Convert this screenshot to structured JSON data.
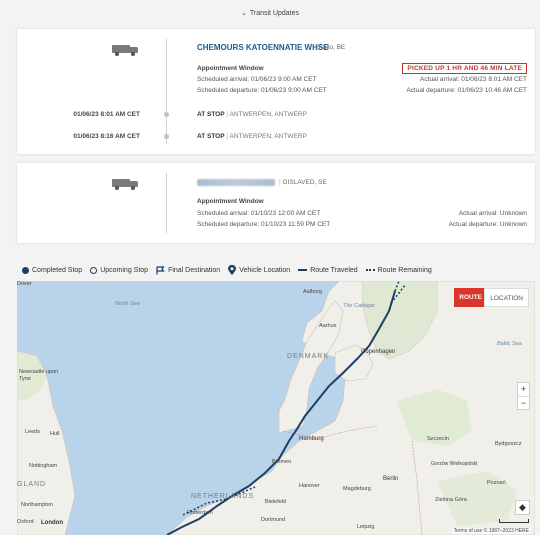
{
  "transit_updates": {
    "label": "Transit Updates"
  },
  "stop1": {
    "name": "CHEMOURS KATOENNATIE WHSE",
    "location": "Kallo, BE",
    "appointment_label": "Appointment Window",
    "scheduled_arrival": "Scheduled arrival: 01/06/23 9:00 AM CET",
    "scheduled_departure": "Scheduled departure: 01/06/23 9:00 AM CET",
    "status_badge": "PICKED UP 1 HR AND 46 MIN LATE",
    "actual_arrival": "Actual arrival: 01/06/23 8:01 AM CET",
    "actual_departure": "Actual departure: 01/06/23 10:46 AM CET",
    "events": [
      {
        "time": "01/06/23 8:01 AM CET",
        "status": "AT STOP",
        "place": "ANTWERPEN, ANTWERP"
      },
      {
        "time": "01/06/23 8:16 AM CET",
        "status": "AT STOP",
        "place": "ANTWERPEN, ANTWERP"
      }
    ]
  },
  "stop2": {
    "location": "GISLAVED, SE",
    "appointment_label": "Appointment Window",
    "scheduled_arrival": "Scheduled arrival: 01/10/23 12:00 AM CET",
    "scheduled_departure": "Scheduled departure: 01/10/23 11:59 PM CET",
    "actual_arrival": "Actual arrival: Unknown",
    "actual_departure": "Actual departure: Unknown"
  },
  "legend": {
    "completed": "Completed Stop",
    "upcoming": "Upcoming Stop",
    "final": "Final Destination",
    "vehicle": "Vehicle Location",
    "traveled": "Route Traveled",
    "remaining": "Route Remaining"
  },
  "map": {
    "route_button": "ROUTE",
    "location_button": "LOCATION",
    "zoom_in": "+",
    "zoom_out": "−",
    "terms": "Terms of use   © 1987–2023 HERE",
    "labels": {
      "north_sea": "North Sea",
      "baltic_sea": "Baltic Sea",
      "the_cattegat": "The Cattegat",
      "aalborg": "Aalborg",
      "aarhus": "Aarhus",
      "denmark": "DENMARK",
      "copenhagen": "Copenhagen",
      "hamburg": "Hamburg",
      "bremen": "Bremen",
      "hanover": "Hanover",
      "magdeburg": "Magdeburg",
      "berlin": "Berlin",
      "szczecin": "Szczecin",
      "bydgoszcz": "Bydgoszcz",
      "gorzow": "Gorzów Wielkopolski",
      "poznan": "Poznań",
      "zielona_gora": "Zielona Góra",
      "leipzig": "Leipzig",
      "dortmund": "Dortmund",
      "bielefeld": "Bielefeld",
      "rotterdam": "Rotterdam",
      "netherlands": "NETHERLANDS",
      "newcastle": "Newcastle upon Tyne",
      "leeds": "Leeds",
      "hull": "Hull",
      "nottingham": "Nottingham",
      "england": "GLAND",
      "northampton": "Northampton",
      "london": "London",
      "oxford": "Oxford",
      "dover": "Dover",
      "road_a7": "A7",
      "road_e45": "E45",
      "road_a1": "A1",
      "road_a2": "A2",
      "road_a4": "A4",
      "road_a11": "A11",
      "road_a5": "A5",
      "road_m1": "M1",
      "road_m4": "M4"
    }
  }
}
